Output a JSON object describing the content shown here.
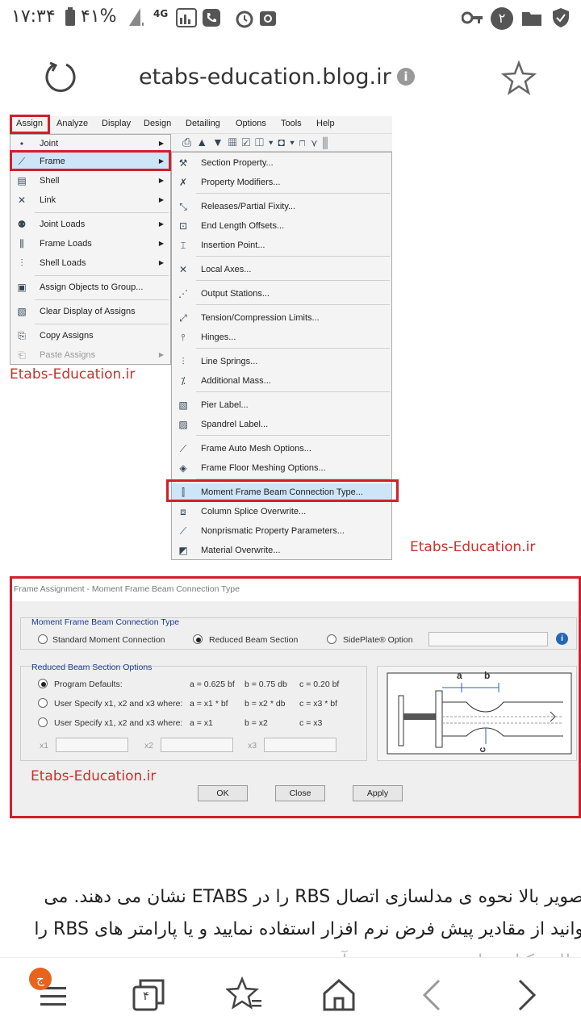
{
  "status_bar": {
    "time": "۱۷:۳۴",
    "battery": "۴۱%",
    "network": "4G",
    "notification_count": "۲"
  },
  "url_bar": {
    "url": "etabs-education.blog.ir"
  },
  "menu_bar": [
    "Assign",
    "Analyze",
    "Display",
    "Design",
    "Detailing",
    "Options",
    "Tools",
    "Help"
  ],
  "assign_menu": [
    "Joint",
    "Frame",
    "Shell",
    "Link",
    "Joint Loads",
    "Frame Loads",
    "Shell Loads",
    "Assign Objects to Group...",
    "Clear Display of Assigns",
    "Copy Assigns",
    "Paste Assigns"
  ],
  "frame_submenu": [
    "Section Property...",
    "Property Modifiers...",
    "Releases/Partial Fixity...",
    "End Length Offsets...",
    "Insertion Point...",
    "Local Axes...",
    "Output Stations...",
    "Tension/Compression Limits...",
    "Hinges...",
    "Line Springs...",
    "Additional Mass...",
    "Pier Label...",
    "Spandrel Label...",
    "Frame Auto Mesh Options...",
    "Frame Floor Meshing Options...",
    "Moment Frame Beam Connection Type...",
    "Column Splice Overwrite...",
    "Nonprismatic Property Parameters...",
    "Material Overwrite..."
  ],
  "watermark": "Etabs-Education.ir",
  "dialog": {
    "title": "Frame Assignment - Moment Frame Beam Connection Type",
    "group1_label": "Moment Frame Beam Connection Type",
    "opt_standard": "Standard Moment Connection",
    "opt_rbs": "Reduced Beam Section",
    "opt_sideplate": "SidePlate® Option",
    "group2_label": "Reduced Beam Section Options",
    "rows": [
      {
        "label": "Program Defaults:",
        "a": "a = 0.625 bf",
        "b": "b = 0.75 db",
        "c": "c = 0.20 bf"
      },
      {
        "label": "User Specify x1, x2 and x3 where:",
        "a": "a = x1 * bf",
        "b": "b = x2 * db",
        "c": "c = x3 * bf"
      },
      {
        "label": "User Specify x1, x2 and x3 where:",
        "a": "a = x1",
        "b": "b = x2",
        "c": "c = x3"
      }
    ],
    "x1": "x1",
    "x2": "x2",
    "x3": "x3",
    "diag_a": "a",
    "diag_b": "b",
    "diag_c": "c",
    "ok": "OK",
    "close": "Close",
    "apply": "Apply"
  },
  "article": {
    "line1": "تصویر بالا نحوه ی مدلسازی اتصال RBS را در ETABS نشان می دهند. می",
    "line2": "توانید از مقادیر پیش فرض نرم افزار استفاده نمایید و یا پارامتر های RBS را",
    "line3": "مطابق کتاب های مرجع به دست آورید"
  },
  "bottom_nav": {
    "menu_badge": "ج",
    "tabs_count": "۴"
  }
}
